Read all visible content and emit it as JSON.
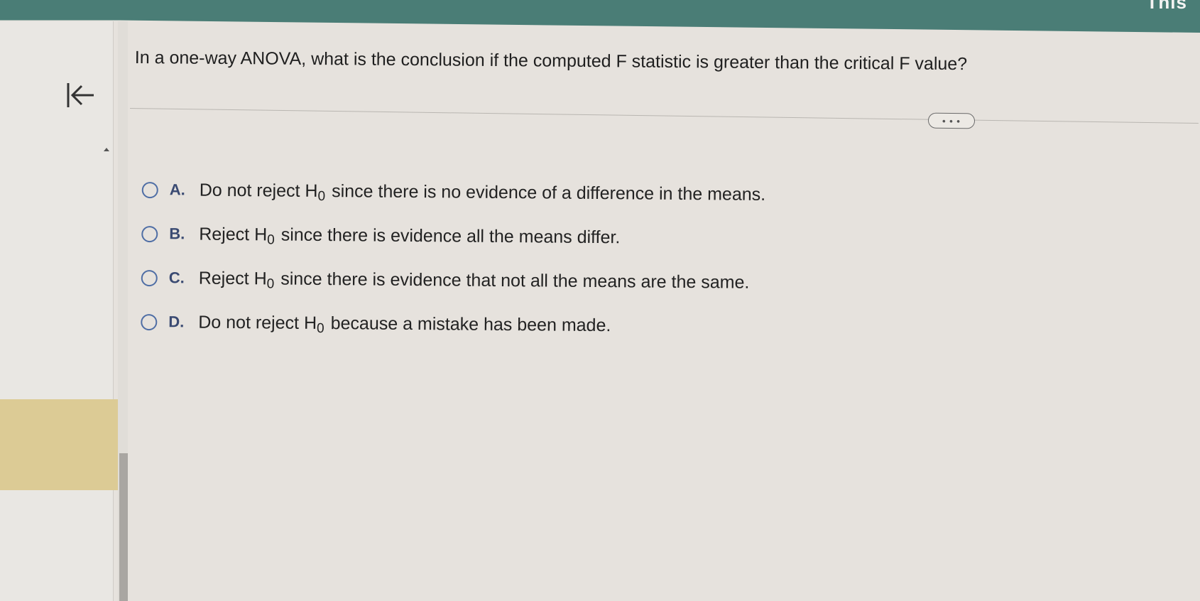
{
  "header": {
    "corner_text": "This",
    "accent_color": "#4a7d76"
  },
  "sidebar": {
    "back_icon": "first-page-icon",
    "highlight_color": "#dccb95"
  },
  "question": {
    "text": "In a one-way ANOVA, what is the conclusion if the computed F statistic is greater than the critical F value?"
  },
  "more_button": {
    "label": "• • •"
  },
  "options": [
    {
      "letter": "A.",
      "pre": "Do not reject",
      "h": "H",
      "sub": "0",
      "post": "since there is no evidence of a difference in the means."
    },
    {
      "letter": "B.",
      "pre": "Reject",
      "h": "H",
      "sub": "0",
      "post": "since there is evidence all the means differ."
    },
    {
      "letter": "C.",
      "pre": "Reject",
      "h": "H",
      "sub": "0",
      "post": "since there is evidence that not all the means are the same."
    },
    {
      "letter": "D.",
      "pre": "Do not reject",
      "h": "H",
      "sub": "0",
      "post": "because a mistake has been made."
    }
  ]
}
